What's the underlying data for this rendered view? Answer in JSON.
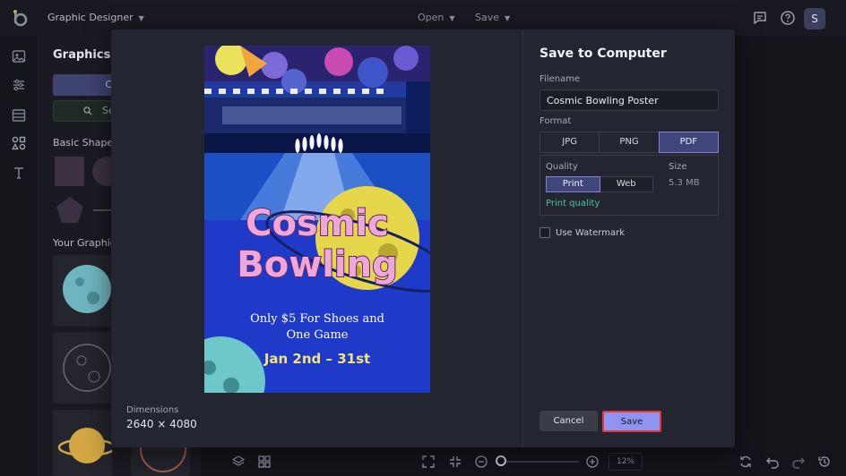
{
  "topbar": {
    "app_title": "Graphic Designer",
    "menu_open": "Open",
    "menu_save": "Save",
    "avatar_initial": "S"
  },
  "panel": {
    "title": "Graphics",
    "btn_primary_fragment": "C",
    "btn_search_fragment": "Se",
    "section_basic_shapes": "Basic Shapes",
    "section_your_graphics": "Your Graphics"
  },
  "bottombar": {
    "zoom_level": "12%"
  },
  "poster": {
    "headline_1": "Cosmic",
    "headline_2": "Bowling",
    "tagline_1": "Only $5 For Shoes and",
    "tagline_2": "One Game",
    "dates": "Jan 2nd – 31st"
  },
  "modal": {
    "title": "Save to Computer",
    "dimensions_label": "Dimensions",
    "dimensions_value": "2640 × 4080",
    "filename_label": "Filename",
    "filename_value": "Cosmic Bowling Poster",
    "format_label": "Format",
    "formats": [
      "JPG",
      "PNG",
      "PDF"
    ],
    "selected_format": "PDF",
    "quality_label": "Quality",
    "qualities": [
      "Print",
      "Web"
    ],
    "selected_quality": "Print",
    "quality_note": "Print quality",
    "size_label": "Size",
    "size_value": "5.3 MB",
    "watermark_label": "Use Watermark",
    "watermark_checked": false,
    "cancel_label": "Cancel",
    "save_label": "Save"
  },
  "colors": {
    "accent": "#8f94f0",
    "selected_bg": "#40457a",
    "quality_note": "#4fc3a1",
    "highlight_border": "#e53535"
  }
}
